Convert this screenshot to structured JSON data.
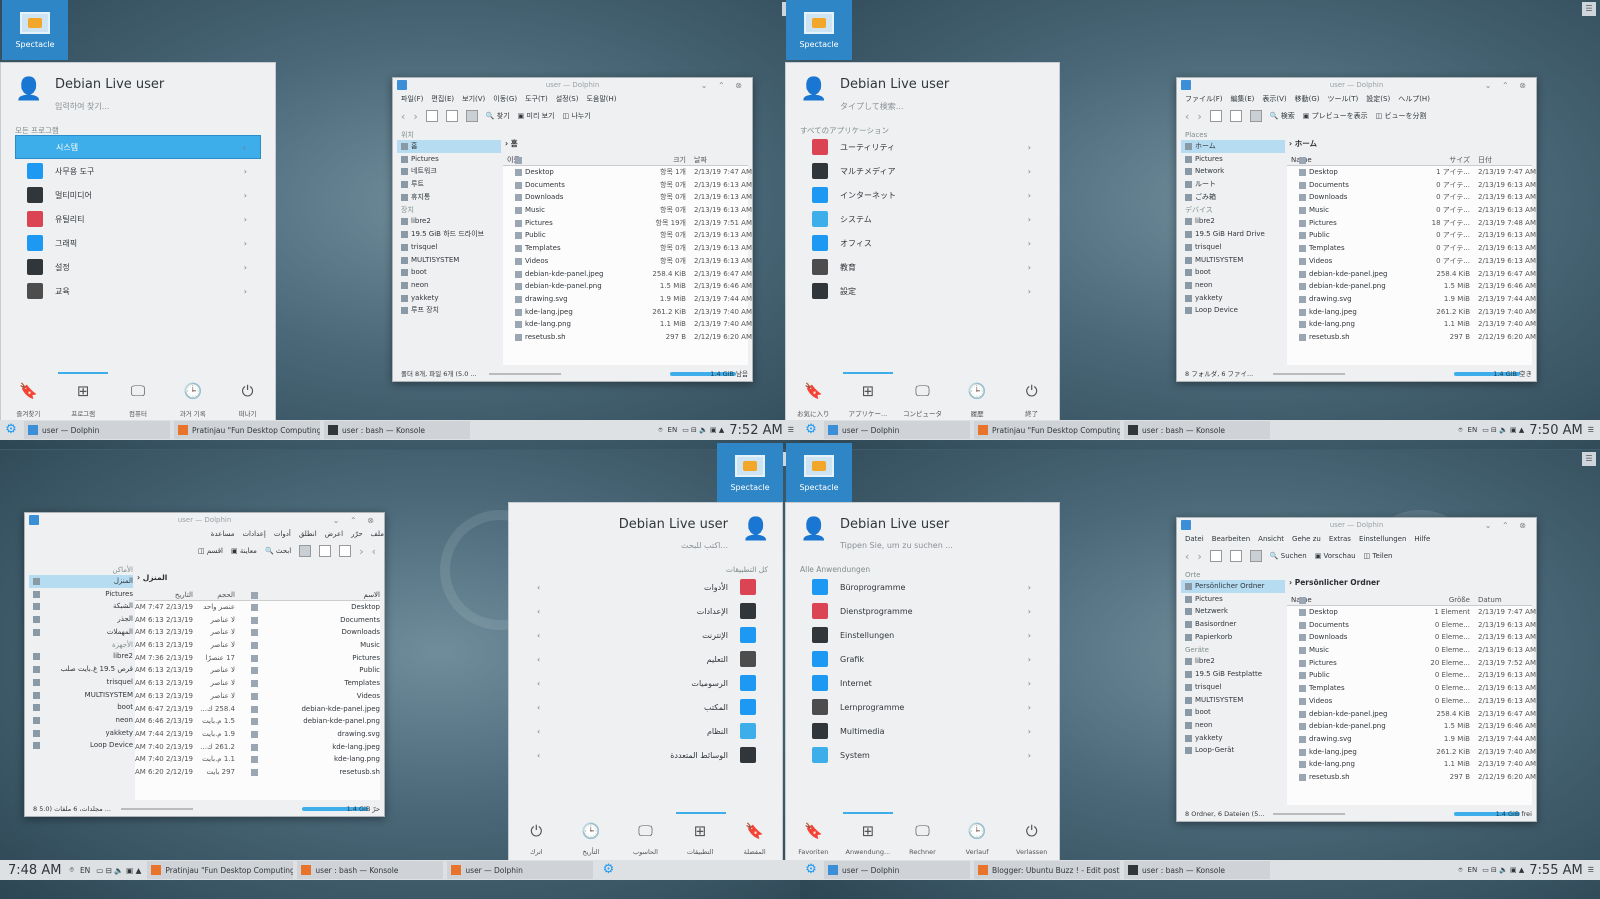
{
  "colors": {
    "accent": "#3daee9",
    "spectacle": "#2f86c6",
    "panel": "#dee1e4"
  },
  "quadrants": [
    {
      "spectacle": "Spectacle",
      "menu": {
        "user": "Debian Live user",
        "hint": "입력하여 찾기...",
        "section": "모든 프로그램",
        "items": [
          {
            "label": "시스템",
            "icon": "system-icon",
            "color": "#3daee9"
          },
          {
            "label": "사무용 도구",
            "icon": "office-icon",
            "color": "#1d99f3"
          },
          {
            "label": "멀티미디어",
            "icon": "multimedia-icon",
            "color": "#31363b"
          },
          {
            "label": "유틸리티",
            "icon": "utilities-icon",
            "color": "#da4453"
          },
          {
            "label": "그래픽",
            "icon": "graphics-icon",
            "color": "#1d99f3"
          },
          {
            "label": "설정",
            "icon": "settings-icon",
            "color": "#31363b"
          },
          {
            "label": "교육",
            "icon": "education-icon",
            "color": "#4d4d4d"
          }
        ],
        "tabs": [
          "즐겨찾기",
          "프로그램",
          "컴퓨터",
          "과거 기록",
          "떠나기"
        ]
      },
      "dolphin": {
        "title": "user — Dolphin",
        "menus": [
          "파일(F)",
          "편집(E)",
          "보기(V)",
          "이동(G)",
          "도구(T)",
          "설정(S)",
          "도움말(H)"
        ],
        "tools": [
          "찾기",
          "미리 보기",
          "나누기"
        ],
        "crumb": "홈",
        "places_h": "위치",
        "places": [
          "홈",
          "Pictures",
          "네트워크",
          "루트",
          "휴지통"
        ],
        "devices_h": "장치",
        "devices": [
          "libre2",
          "19.5 GiB 하드 드라이브",
          "trisquel",
          "MULTISYSTEM",
          "boot",
          "neon",
          "yakkety",
          "루프 장치"
        ],
        "cols": [
          "이름",
          "크기",
          "날짜"
        ],
        "files": [
          [
            "Desktop",
            "항목 1개",
            "2/13/19 7:47 AM"
          ],
          [
            "Documents",
            "항목 0개",
            "2/13/19 6:13 AM"
          ],
          [
            "Downloads",
            "항목 0개",
            "2/13/19 6:13 AM"
          ],
          [
            "Music",
            "항목 0개",
            "2/13/19 6:13 AM"
          ],
          [
            "Pictures",
            "항목 19개",
            "2/13/19 7:51 AM"
          ],
          [
            "Public",
            "항목 0개",
            "2/13/19 6:13 AM"
          ],
          [
            "Templates",
            "항목 0개",
            "2/13/19 6:13 AM"
          ],
          [
            "Videos",
            "항목 0개",
            "2/13/19 6:13 AM"
          ],
          [
            "debian-kde-panel.jpeg",
            "258.4 KiB",
            "2/13/19 6:47 AM"
          ],
          [
            "debian-kde-panel.png",
            "1.5 MiB",
            "2/13/19 6:46 AM"
          ],
          [
            "drawing.svg",
            "1.9 MiB",
            "2/13/19 7:44 AM"
          ],
          [
            "kde-lang.jpeg",
            "261.2 KiB",
            "2/13/19 7:40 AM"
          ],
          [
            "kde-lang.png",
            "1.1 MiB",
            "2/13/19 7:40 AM"
          ],
          [
            "resetusb.sh",
            "297 B",
            "2/12/19 6:20 AM"
          ]
        ],
        "status": "폴더 8개, 파일 6개 (5.0 ...",
        "free": "1.4 GiB 남음"
      },
      "panel": {
        "tasks": [
          "user — Dolphin",
          "Pratinjau \"Fun Desktop Computing...",
          "user : bash — Konsole"
        ],
        "lang": "EN",
        "clock": "7:52 AM"
      }
    },
    {
      "spectacle": "Spectacle",
      "menu": {
        "user": "Debian Live user",
        "hint": "タイプして検索...",
        "section": "すべてのアプリケーション",
        "items": [
          {
            "label": "ユーティリティ",
            "icon": "utilities-icon",
            "color": "#da4453"
          },
          {
            "label": "マルチメディア",
            "icon": "multimedia-icon",
            "color": "#31363b"
          },
          {
            "label": "インターネット",
            "icon": "internet-icon",
            "color": "#1d99f3"
          },
          {
            "label": "システム",
            "icon": "system-icon",
            "color": "#3daee9"
          },
          {
            "label": "オフィス",
            "icon": "office-icon",
            "color": "#1d99f3"
          },
          {
            "label": "教育",
            "icon": "education-icon",
            "color": "#4d4d4d"
          },
          {
            "label": "設定",
            "icon": "settings-icon",
            "color": "#31363b"
          }
        ],
        "tabs": [
          "お気に入り",
          "アプリケー...",
          "コンピュータ",
          "履歴",
          "終了"
        ]
      },
      "dolphin": {
        "title": "user — Dolphin",
        "menus": [
          "ファイル(F)",
          "編集(E)",
          "表示(V)",
          "移動(G)",
          "ツール(T)",
          "設定(S)",
          "ヘルプ(H)"
        ],
        "tools": [
          "検索",
          "プレビューを表示",
          "ビューを分割"
        ],
        "crumb": "ホーム",
        "places_h": "Places",
        "places": [
          "ホーム",
          "Pictures",
          "Network",
          "ルート",
          "ごみ箱"
        ],
        "devices_h": "デバイス",
        "devices": [
          "libre2",
          "19.5 GiB Hard Drive",
          "trisquel",
          "MULTISYSTEM",
          "boot",
          "neon",
          "yakkety",
          "Loop Device"
        ],
        "cols": [
          "Name",
          "サイズ",
          "日付"
        ],
        "files": [
          [
            "Desktop",
            "1 アイテ...",
            "2/13/19 7:47 AM"
          ],
          [
            "Documents",
            "0 アイテ...",
            "2/13/19 6:13 AM"
          ],
          [
            "Downloads",
            "0 アイテ...",
            "2/13/19 6:13 AM"
          ],
          [
            "Music",
            "0 アイテ...",
            "2/13/19 6:13 AM"
          ],
          [
            "Pictures",
            "18 アイテ...",
            "2/13/19 7:48 AM"
          ],
          [
            "Public",
            "0 アイテ...",
            "2/13/19 6:13 AM"
          ],
          [
            "Templates",
            "0 アイテ...",
            "2/13/19 6:13 AM"
          ],
          [
            "Videos",
            "0 アイテ...",
            "2/13/19 6:13 AM"
          ],
          [
            "debian-kde-panel.jpeg",
            "258.4 KiB",
            "2/13/19 6:47 AM"
          ],
          [
            "debian-kde-panel.png",
            "1.5 MiB",
            "2/13/19 6:46 AM"
          ],
          [
            "drawing.svg",
            "1.9 MiB",
            "2/13/19 7:44 AM"
          ],
          [
            "kde-lang.jpeg",
            "261.2 KiB",
            "2/13/19 7:40 AM"
          ],
          [
            "kde-lang.png",
            "1.1 MiB",
            "2/13/19 7:40 AM"
          ],
          [
            "resetusb.sh",
            "297 B",
            "2/12/19 6:20 AM"
          ]
        ],
        "status": "8 フォルダ, 6 ファイ...",
        "free": "1.4 GiB 空き"
      },
      "panel": {
        "tasks": [
          "user — Dolphin",
          "Pratinjau \"Fun Desktop Computing...",
          "user : bash — Konsole"
        ],
        "lang": "EN",
        "clock": "7:50 AM"
      }
    },
    {
      "spectacle": "Spectacle",
      "menu": {
        "user": "Debian Live user",
        "hint": "اكتب للبحث...",
        "section": "كل التطبيقات",
        "items": [
          {
            "label": "الأدوات",
            "icon": "utilities-icon",
            "color": "#da4453"
          },
          {
            "label": "الإعدادات",
            "icon": "settings-icon",
            "color": "#31363b"
          },
          {
            "label": "الإنترنت",
            "icon": "internet-icon",
            "color": "#1d99f3"
          },
          {
            "label": "التعليم",
            "icon": "education-icon",
            "color": "#4d4d4d"
          },
          {
            "label": "الرسوميات",
            "icon": "graphics-icon",
            "color": "#1d99f3"
          },
          {
            "label": "المكتب",
            "icon": "office-icon",
            "color": "#1d99f3"
          },
          {
            "label": "النظام",
            "icon": "system-icon",
            "color": "#3daee9"
          },
          {
            "label": "الوسائط المتعددة",
            "icon": "multimedia-icon",
            "color": "#31363b"
          }
        ],
        "tabs": [
          "المفضلة",
          "التطبيقات",
          "الحاسوب",
          "التأريخ",
          "اترك"
        ]
      },
      "dolphin": {
        "title": "user — Dolphin",
        "menus": [
          "ملف",
          "حرّر",
          "اعرض",
          "انطلق",
          "أدوات",
          "إعدادات",
          "مساعدة"
        ],
        "tools": [
          "ابحث",
          "معاينة",
          "اقسم"
        ],
        "crumb": "المنزل",
        "places_h": "الأماكن",
        "places": [
          "المنزل",
          "Pictures",
          "الشبكة",
          "الجذر",
          "المهملات"
        ],
        "devices_h": "الأجهزة",
        "devices": [
          "libre2",
          "قرص 19.5 غ.بايت صلب",
          "trisquel",
          "MULTISYSTEM",
          "boot",
          "neon",
          "yakkety",
          "Loop Device"
        ],
        "cols": [
          "الاسم",
          "الحجم",
          "التاريخ"
        ],
        "files": [
          [
            "Desktop",
            "عنصر واحد",
            "2/13/19 7:47 AM"
          ],
          [
            "Documents",
            "لا عناصر",
            "2/13/19 6:13 AM"
          ],
          [
            "Downloads",
            "لا عناصر",
            "2/13/19 6:13 AM"
          ],
          [
            "Music",
            "لا عناصر",
            "2/13/19 6:13 AM"
          ],
          [
            "Pictures",
            "17 عنصرًا",
            "2/13/19 7:36 AM"
          ],
          [
            "Public",
            "لا عناصر",
            "2/13/19 6:13 AM"
          ],
          [
            "Templates",
            "لا عناصر",
            "2/13/19 6:13 AM"
          ],
          [
            "Videos",
            "لا عناصر",
            "2/13/19 6:13 AM"
          ],
          [
            "debian-kde-panel.jpeg",
            "258.4 ك...",
            "2/13/19 6:47 AM"
          ],
          [
            "debian-kde-panel.png",
            "1.5 م.بايت",
            "2/13/19 6:46 AM"
          ],
          [
            "drawing.svg",
            "1.9 م.بايت",
            "2/13/19 7:44 AM"
          ],
          [
            "kde-lang.jpeg",
            "261.2 ك...",
            "2/13/19 7:40 AM"
          ],
          [
            "kde-lang.png",
            "1.1 م.بايت",
            "2/13/19 7:40 AM"
          ],
          [
            "resetusb.sh",
            "297 بايت",
            "2/12/19 6:20 AM"
          ]
        ],
        "status": "8 مجلدات، 6 ملفات (5.0 ...",
        "free": "1.4 GiB حرّ"
      },
      "panel": {
        "tasks": [
          "Pratinjau \"Fun Desktop Computing...",
          "user : bash — Konsole",
          "user — Dolphin"
        ],
        "lang": "EN",
        "clock": "7:48 AM"
      }
    },
    {
      "spectacle": "Spectacle",
      "menu": {
        "user": "Debian Live user",
        "hint": "Tippen Sie, um zu suchen ...",
        "section": "Alle Anwendungen",
        "items": [
          {
            "label": "Büroprogramme",
            "icon": "office-icon",
            "color": "#1d99f3"
          },
          {
            "label": "Dienstprogramme",
            "icon": "utilities-icon",
            "color": "#da4453"
          },
          {
            "label": "Einstellungen",
            "icon": "settings-icon",
            "color": "#31363b"
          },
          {
            "label": "Grafik",
            "icon": "graphics-icon",
            "color": "#1d99f3"
          },
          {
            "label": "Internet",
            "icon": "internet-icon",
            "color": "#1d99f3"
          },
          {
            "label": "Lernprogramme",
            "icon": "education-icon",
            "color": "#4d4d4d"
          },
          {
            "label": "Multimedia",
            "icon": "multimedia-icon",
            "color": "#31363b"
          },
          {
            "label": "System",
            "icon": "system-icon",
            "color": "#3daee9"
          }
        ],
        "tabs": [
          "Favoriten",
          "Anwendung...",
          "Rechner",
          "Verlauf",
          "Verlassen"
        ]
      },
      "dolphin": {
        "title": "user — Dolphin",
        "menus": [
          "Datei",
          "Bearbeiten",
          "Ansicht",
          "Gehe zu",
          "Extras",
          "Einstellungen",
          "Hilfe"
        ],
        "tools": [
          "Suchen",
          "Vorschau",
          "Teilen"
        ],
        "crumb": "Persönlicher Ordner",
        "places_h": "Orte",
        "places": [
          "Persönlicher Ordner",
          "Pictures",
          "Netzwerk",
          "Basisordner",
          "Papierkorb"
        ],
        "devices_h": "Geräte",
        "devices": [
          "libre2",
          "19.5 GiB Festplatte",
          "trisquel",
          "MULTISYSTEM",
          "boot",
          "neon",
          "yakkety",
          "Loop-Gerät"
        ],
        "cols": [
          "Name",
          "Größe",
          "Datum"
        ],
        "files": [
          [
            "Desktop",
            "1 Element",
            "2/13/19 7:47 AM"
          ],
          [
            "Documents",
            "0 Eleme...",
            "2/13/19 6:13 AM"
          ],
          [
            "Downloads",
            "0 Eleme...",
            "2/13/19 6:13 AM"
          ],
          [
            "Music",
            "0 Eleme...",
            "2/13/19 6:13 AM"
          ],
          [
            "Pictures",
            "20 Eleme...",
            "2/13/19 7:52 AM"
          ],
          [
            "Public",
            "0 Eleme...",
            "2/13/19 6:13 AM"
          ],
          [
            "Templates",
            "0 Eleme...",
            "2/13/19 6:13 AM"
          ],
          [
            "Videos",
            "0 Eleme...",
            "2/13/19 6:13 AM"
          ],
          [
            "debian-kde-panel.jpeg",
            "258.4 KiB",
            "2/13/19 6:47 AM"
          ],
          [
            "debian-kde-panel.png",
            "1.5 MiB",
            "2/13/19 6:46 AM"
          ],
          [
            "drawing.svg",
            "1.9 MiB",
            "2/13/19 7:44 AM"
          ],
          [
            "kde-lang.jpeg",
            "261.2 KiB",
            "2/13/19 7:40 AM"
          ],
          [
            "kde-lang.png",
            "1.1 MiB",
            "2/13/19 7:40 AM"
          ],
          [
            "resetusb.sh",
            "297 B",
            "2/12/19 6:20 AM"
          ]
        ],
        "status": "8 Ordner, 6 Dateien (5...",
        "free": "1.4 GiB frei"
      },
      "panel": {
        "tasks": [
          "user — Dolphin",
          "Blogger: Ubuntu Buzz ! - Edit post -...",
          "user : bash — Konsole"
        ],
        "lang": "EN",
        "clock": "7:55 AM"
      }
    }
  ]
}
